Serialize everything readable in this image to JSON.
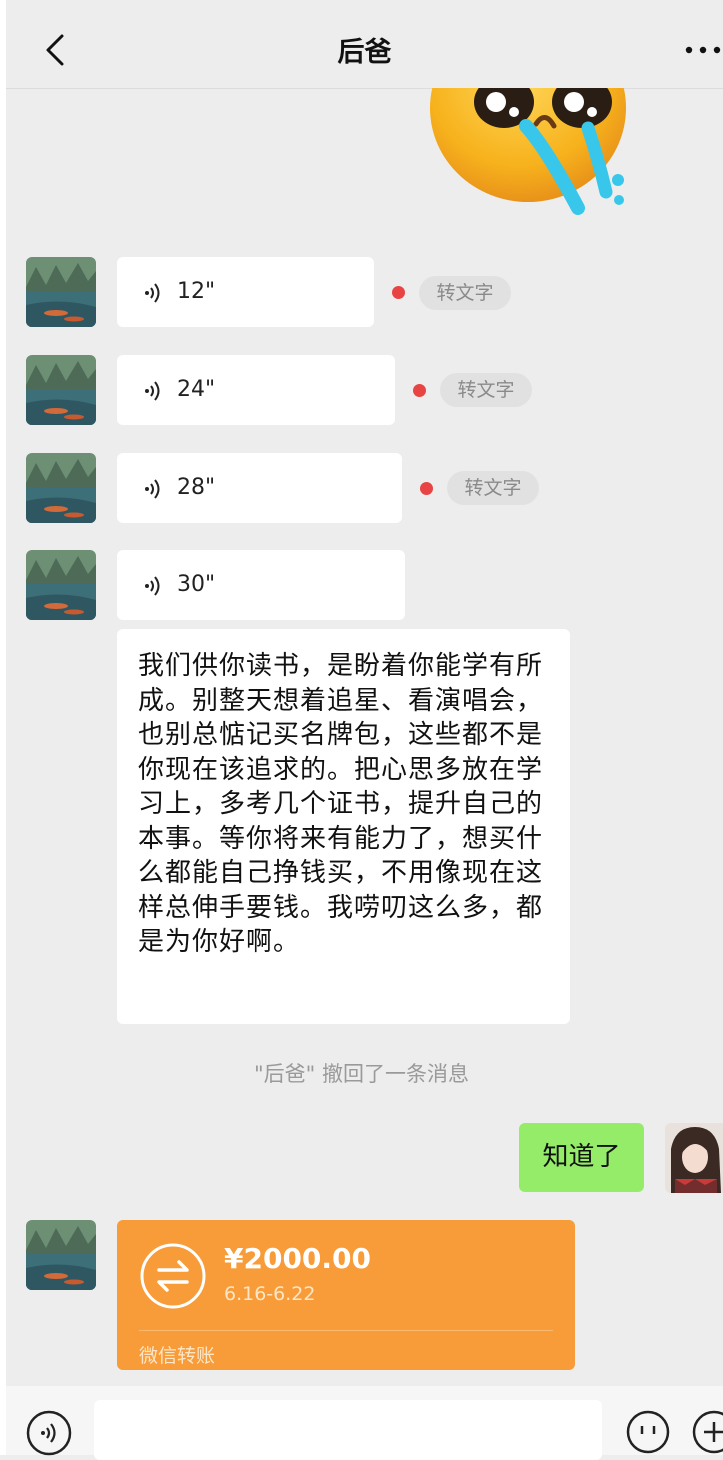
{
  "header": {
    "title": "后爸"
  },
  "messages": {
    "voice": [
      {
        "duration": "12\"",
        "to_text": "转文字"
      },
      {
        "duration": "24\"",
        "to_text": "转文字"
      },
      {
        "duration": "28\"",
        "to_text": "转文字"
      },
      {
        "duration": "30\""
      }
    ],
    "text": "我们供你读书，是盼着你能学有所成。别整天想着追星、看演唱会，也别总惦记买名牌包，这些都不是你现在该追求的。把心思多放在学习上，多考几个证书，提升自己的本事。等你将来有能力了，想买什么都能自己挣钱买，不用像现在这样总伸手要钱。我唠叨这么多，都是为你好啊。",
    "recall_notice": "\"后爸\" 撤回了一条消息",
    "sent_reply": "知道了",
    "transfer": {
      "amount": "¥2000.00",
      "date": "6.16-6.22",
      "label": "微信转账"
    }
  },
  "colors": {
    "background": "#ededed",
    "sent_bubble": "#95ec69",
    "transfer": "#f79c38",
    "unread_dot": "#e84444"
  }
}
